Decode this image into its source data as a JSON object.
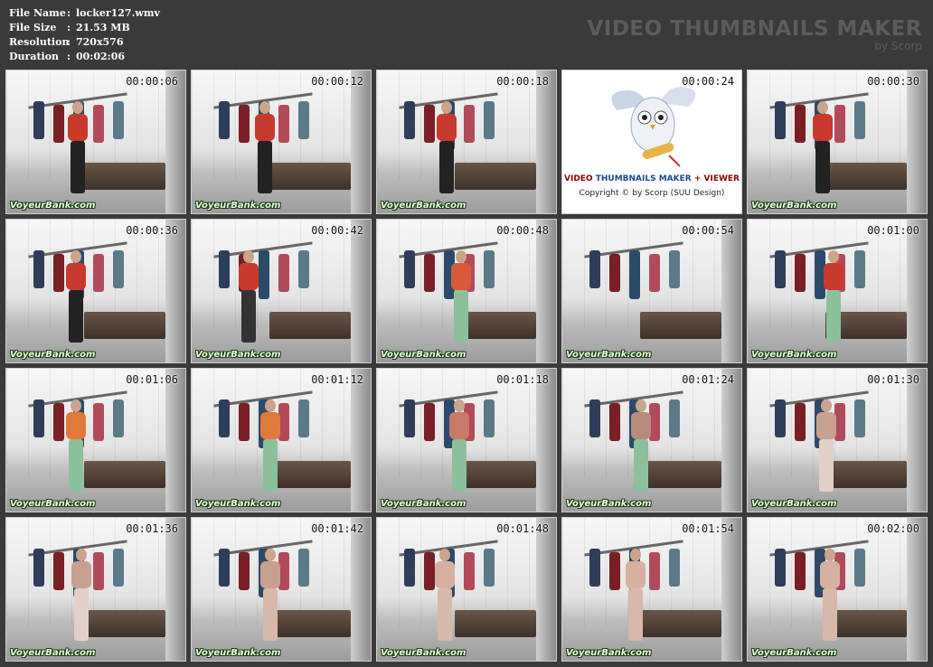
{
  "file_info": {
    "rows": [
      {
        "key": "File Name",
        "value": "locker127.wmv"
      },
      {
        "key": "File Size",
        "value": "21.53 MB"
      },
      {
        "key": "Resolution",
        "value": "720x576"
      },
      {
        "key": "Duration",
        "value": "00:02:06"
      }
    ],
    "separator": ":"
  },
  "brand": {
    "title": "VIDEO THUMBNAILS MAKER",
    "subtitle": "by Scorp"
  },
  "logo_tile": {
    "timestamp": "00:00:24",
    "line1_a": "VIDEO ",
    "line1_b": "THUMBNAILS MAKER",
    "line1_c": " + VIEWER",
    "line2": "Copyright © by Scorp (SUU Design)"
  },
  "watermark": "VoyeurBank.com",
  "thumbnails": [
    {
      "time": "00:00:06"
    },
    {
      "time": "00:00:12"
    },
    {
      "time": "00:00:18"
    },
    {
      "time": "00:00:24",
      "logo": true
    },
    {
      "time": "00:00:30"
    },
    {
      "time": "00:00:36"
    },
    {
      "time": "00:00:42"
    },
    {
      "time": "00:00:48"
    },
    {
      "time": "00:00:54"
    },
    {
      "time": "00:01:00"
    },
    {
      "time": "00:01:06"
    },
    {
      "time": "00:01:12"
    },
    {
      "time": "00:01:18"
    },
    {
      "time": "00:01:24"
    },
    {
      "time": "00:01:30"
    },
    {
      "time": "00:01:36"
    },
    {
      "time": "00:01:42"
    },
    {
      "time": "00:01:48"
    },
    {
      "time": "00:01:54"
    },
    {
      "time": "00:02:00"
    }
  ],
  "colors": {
    "background": "#3a3a3a",
    "brand_text": "#5c5c5c",
    "info_text": "#ffffff"
  }
}
